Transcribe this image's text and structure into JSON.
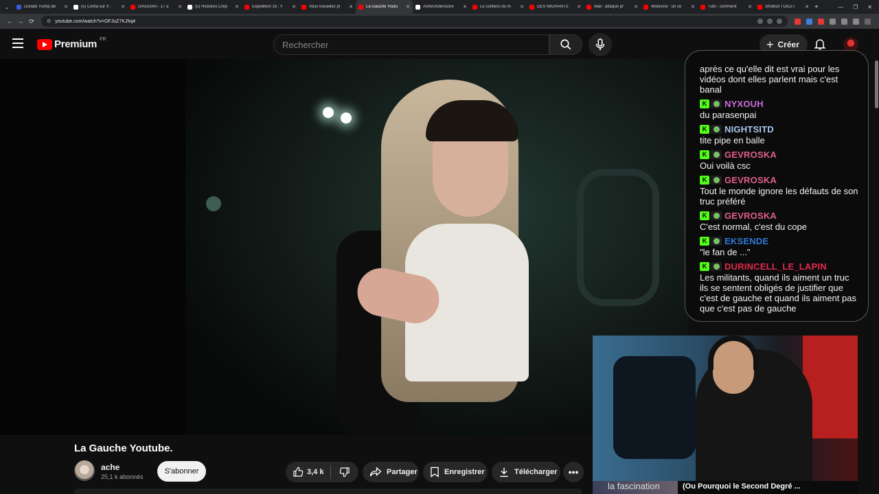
{
  "browser": {
    "tabs": [
      {
        "title": "Donald Trump dé",
        "color": "#3b5bdb"
      },
      {
        "title": "(5) Cerfia sur X :",
        "color": "#ffffff"
      },
      {
        "title": "DIAGORA - 17 a",
        "color": "#ff0000"
      },
      {
        "title": "(5) Histoires Crép",
        "color": "#ffffff"
      },
      {
        "title": "Expedition 33 : F",
        "color": "#ff0000"
      },
      {
        "title": "Vous travaillez pl",
        "color": "#ff0000"
      },
      {
        "title": "La Gauche Youtu",
        "color": "#ff0000",
        "active": true
      },
      {
        "title": "AcheUnderscore",
        "color": "#ffffff"
      },
      {
        "title": "Le contenu du m",
        "color": "#ff0000"
      },
      {
        "title": "DES MIGRANTS",
        "color": "#ff0000"
      },
      {
        "title": "Mali : attaque pr",
        "color": "#ff0000"
      },
      {
        "title": "Wokisme : un so",
        "color": "#ff0000"
      },
      {
        "title": "Tuto : comment",
        "color": "#ff0000"
      },
      {
        "title": "SKIBIDI TOILET",
        "color": "#ff0000"
      }
    ],
    "url": "youtube.com/watch?v=OFJuZ7KJhq4"
  },
  "masthead": {
    "logo_text": "Premium",
    "country": "FR",
    "search_placeholder": "Rechercher",
    "create_label": "Créer"
  },
  "chat": {
    "previous_text": "après ce qu'elle dit est vrai pour les vidéos dont elles parlent mais c'est banal",
    "messages": [
      {
        "user": "NYXOUH",
        "color": "#c86dd7",
        "text": "du parasenpai"
      },
      {
        "user": "NIGHTSITD",
        "color": "#a9c6ef",
        "text": "tite pipe en balle"
      },
      {
        "user": "GEVROSKA",
        "color": "#e0608a",
        "text": "Oui voilà csc"
      },
      {
        "user": "GEVROSKA",
        "color": "#e0608a",
        "text": "Tout le monde ignore les défauts de son truc préféré"
      },
      {
        "user": "GEVROSKA",
        "color": "#e0608a",
        "text": "C'est normal, c'est du cope"
      },
      {
        "user": "EKSENDE",
        "color": "#2f78d6",
        "text": "\"le fan de ...\""
      },
      {
        "user": "DURINCELL_LE_LAPIN",
        "color": "#e22b4e",
        "text": "Les militants, quand ils aiment un truc ils se sentent obligés de justifier que c'est de gauche et quand ils aiment pas que c'est pas de gauche"
      }
    ]
  },
  "webcam": {
    "chip_text": "la fascination",
    "caption": "(Ou Pourquoi le Second Degré ..."
  },
  "video": {
    "title": "La Gauche Youtube.",
    "channel": "ache",
    "subscribers": "25,1 k abonnés",
    "subscribe_label": "S'abonner",
    "likes": "3,4 k",
    "share_label": "Partager",
    "save_label": "Enregistrer",
    "download_label": "Télécharger"
  }
}
